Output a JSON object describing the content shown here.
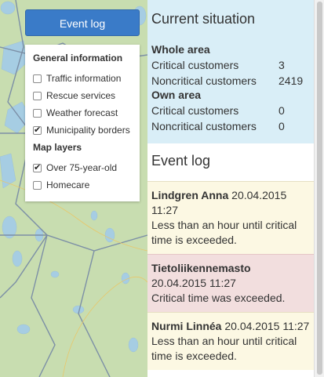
{
  "toolbar": {
    "event_log_button": "Event log"
  },
  "layers": {
    "general_title": "General information",
    "general": [
      {
        "label": "Traffic information",
        "checked": false
      },
      {
        "label": "Rescue services",
        "checked": false
      },
      {
        "label": "Weather forecast",
        "checked": false
      },
      {
        "label": "Municipality borders",
        "checked": true
      }
    ],
    "map_title": "Map layers",
    "map": [
      {
        "label": "Over 75-year-old",
        "checked": true
      },
      {
        "label": "Homecare",
        "checked": false
      }
    ]
  },
  "situation": {
    "title": "Current situation",
    "whole_area": "Whole area",
    "whole": [
      {
        "label": "Critical customers",
        "value": "3"
      },
      {
        "label": "Noncritical customers",
        "value": "2419"
      }
    ],
    "own_area": "Own area",
    "own": [
      {
        "label": "Critical customers",
        "value": "0"
      },
      {
        "label": "Noncritical customers",
        "value": "0"
      }
    ]
  },
  "event_log": {
    "title": "Event log",
    "events": [
      {
        "who": "Lindgren Anna",
        "time": "20.04.2015 11:27",
        "msg": "Less than an hour until critical time is exceeded."
      },
      {
        "who": "Tietoliikennemasto",
        "time": "20.04.2015 11:27",
        "msg": "Critical time was exceeded."
      },
      {
        "who": "Nurmi Linnéa",
        "time": "20.04.2015 11:27",
        "msg": "Less than an hour until critical time is exceeded."
      }
    ]
  },
  "colors": {
    "button": "#3a7bc8",
    "situation_bg": "#d9eef7",
    "warn_bg": "#fcf8e3",
    "error_bg": "#f2dede",
    "map_land": "#c8ddb0"
  }
}
